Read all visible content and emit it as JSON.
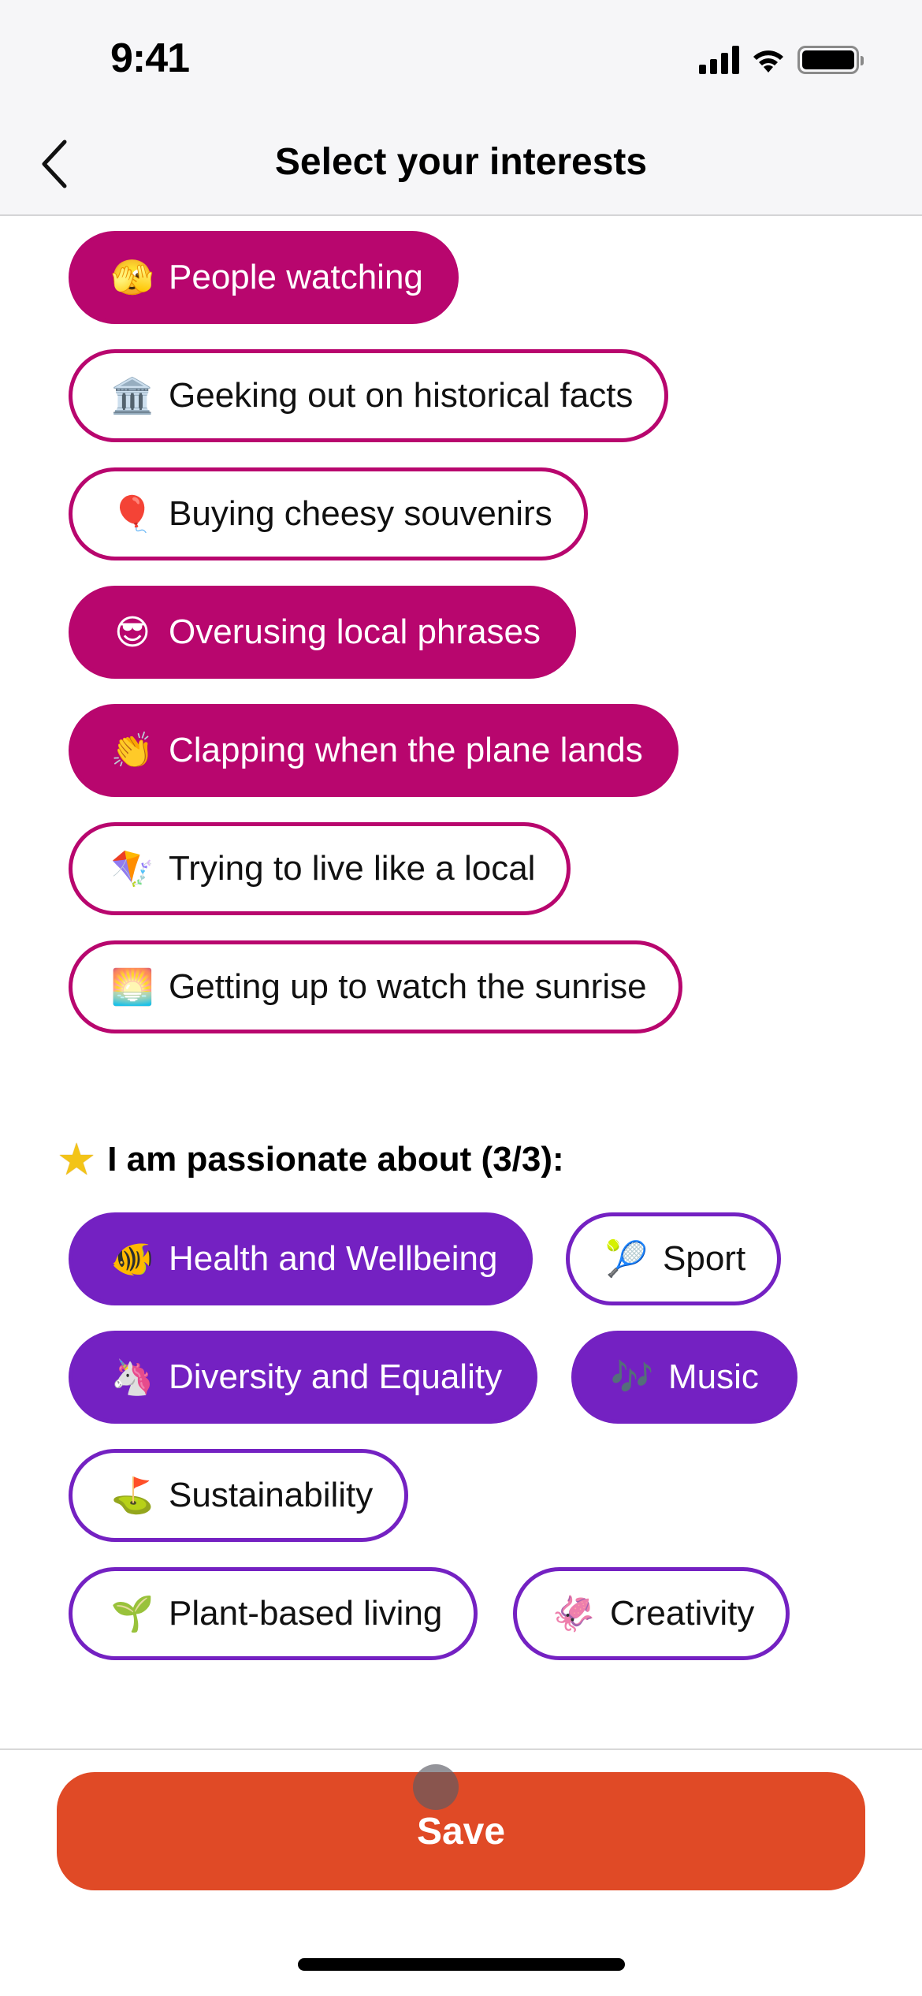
{
  "status_bar": {
    "time": "9:41",
    "icons": [
      "cellular-signal-icon",
      "wifi-icon",
      "battery-icon"
    ]
  },
  "nav": {
    "back_icon": "chevron-left-icon",
    "title": "Select your interests"
  },
  "colors": {
    "magenta": "#b8066e",
    "purple": "#7421c2",
    "save": "#e04a26"
  },
  "fun_interests": [
    {
      "emoji": "🫣",
      "icon": "face-peeking-icon",
      "label": "People watching",
      "selected": true
    },
    {
      "emoji": "🏛️",
      "icon": "classical-building-icon",
      "label": "Geeking out on historical facts",
      "selected": false
    },
    {
      "emoji": "🎈",
      "icon": "balloon-icon",
      "label": "Buying cheesy souvenirs",
      "selected": false
    },
    {
      "emoji": "😎",
      "icon": "sunglasses-face-icon",
      "label": "Overusing local phrases",
      "selected": true
    },
    {
      "emoji": "👏",
      "icon": "clapping-hands-icon",
      "label": "Clapping when the plane lands",
      "selected": true
    },
    {
      "emoji": "🪁",
      "icon": "kite-icon",
      "label": "Trying to live like a local",
      "selected": false
    },
    {
      "emoji": "🌅",
      "icon": "sunrise-icon",
      "label": "Getting up to watch the sunrise",
      "selected": false
    }
  ],
  "passion": {
    "star_icon": "star-icon",
    "heading": "I am passionate about (3/3):",
    "items": [
      {
        "emoji": "🐠",
        "icon": "tropical-fish-icon",
        "label": "Health and Wellbeing",
        "selected": true
      },
      {
        "emoji": "🎾",
        "icon": "tennis-ball-icon",
        "label": "Sport",
        "selected": false
      },
      {
        "emoji": "🦄",
        "icon": "unicorn-icon",
        "label": "Diversity and Equality",
        "selected": true
      },
      {
        "emoji": "🎶",
        "icon": "musical-notes-icon",
        "label": "Music",
        "selected": true
      },
      {
        "emoji": "⛳",
        "icon": "golf-flag-icon",
        "label": "Sustainability",
        "selected": false
      },
      {
        "emoji": "🌱",
        "icon": "seedling-icon",
        "label": "Plant-based living",
        "selected": false
      },
      {
        "emoji": "🦑",
        "icon": "squid-icon",
        "label": "Creativity",
        "selected": false
      }
    ]
  },
  "footer": {
    "save_label": "Save"
  }
}
